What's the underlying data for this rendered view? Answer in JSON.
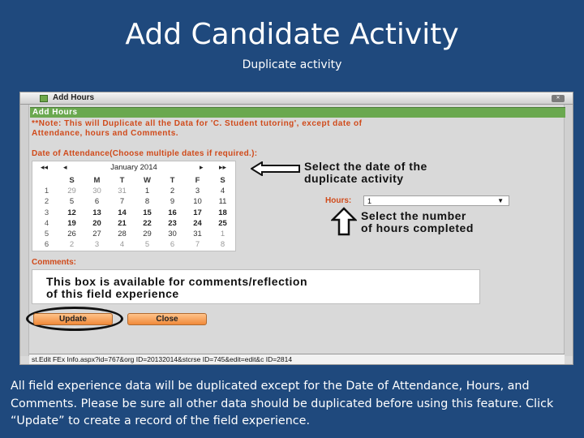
{
  "slide": {
    "title": "Add Candidate Activity",
    "subtitle": "Duplicate activity",
    "caption": "All field experience data will be duplicated except for the Date of Attendance, Hours, and Comments. Please be sure all other data should be duplicated before using this feature. Click “Update” to create a record of the field experience."
  },
  "window": {
    "title": "Add Hours",
    "icon": "app-icon",
    "close_icon": "close-icon",
    "close_label": "✕"
  },
  "panel": {
    "header": "Add Hours",
    "note_line1": "**Note: This will Duplicate all the Data for 'C. Student tutoring', except date of",
    "note_line2": "Attendance, hours and Comments."
  },
  "date_of_attendance": {
    "label": "Date of Attendance(Choose multiple dates if required.):",
    "calendar": {
      "month_label": "January 2014",
      "prev_year": "◂◂",
      "prev_month": "◂",
      "next_month": "▸",
      "next_year": "▸▸",
      "day_headers": [
        "",
        "S",
        "M",
        "T",
        "W",
        "T",
        "F",
        "S"
      ],
      "weeks": [
        [
          "1",
          "29",
          "30",
          "31",
          "1",
          "2",
          "3",
          "4"
        ],
        [
          "2",
          "5",
          "6",
          "7",
          "8",
          "9",
          "10",
          "11"
        ],
        [
          "3",
          "12",
          "13",
          "14",
          "15",
          "16",
          "17",
          "18"
        ],
        [
          "4",
          "19",
          "20",
          "21",
          "22",
          "23",
          "24",
          "25"
        ],
        [
          "5",
          "26",
          "27",
          "28",
          "29",
          "30",
          "31",
          "1"
        ],
        [
          "6",
          "2",
          "3",
          "4",
          "5",
          "6",
          "7",
          "8"
        ]
      ]
    }
  },
  "callouts": {
    "date_line1": "Select the date of the",
    "date_line2": "duplicate activity",
    "hours_line1": "Select the number",
    "hours_line2": "of hours completed"
  },
  "hours": {
    "label": "Hours:",
    "selected": "1",
    "caret": "▼"
  },
  "comments": {
    "label": "Comments:",
    "line1": "This box is available for comments/reflection",
    "line2": "of this field experience"
  },
  "buttons": {
    "update": "Update",
    "close": "Close"
  },
  "status_bar": {
    "url": "st.Edit FEx Info.aspx?id=767&org ID=20132014&stcrse ID=745&edit=edit&c ID=2814"
  },
  "colors": {
    "slide_bg": "#1f497d",
    "panel_header": "#6aa84f",
    "label_orange": "#d04a1a",
    "button_orange": "#f08a3a"
  }
}
